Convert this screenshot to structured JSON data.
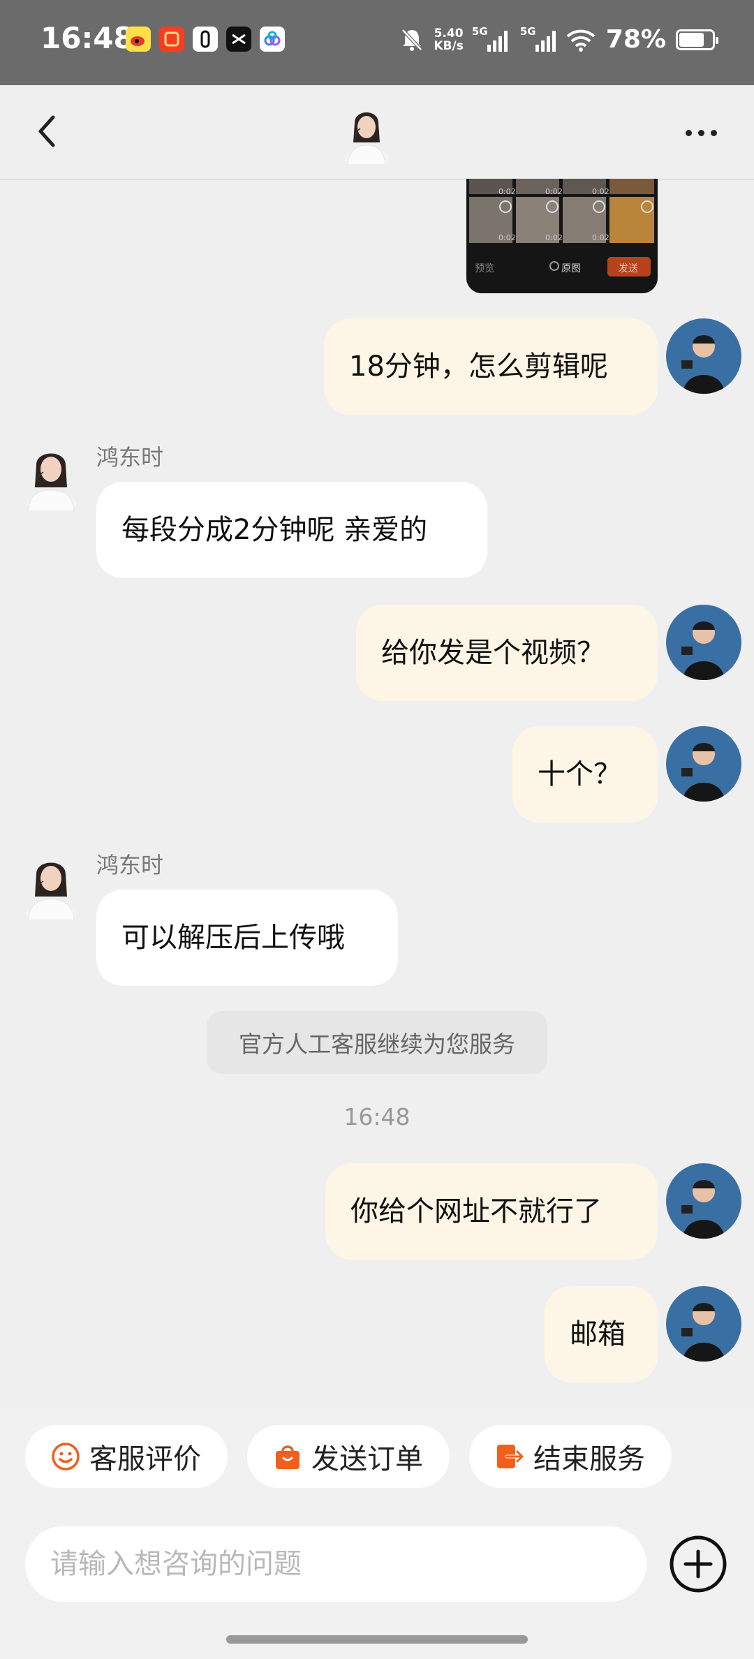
{
  "status_bar": {
    "time": "16:48",
    "net_speed_value": "5.40",
    "net_speed_unit": "KB/s",
    "signal1_label": "5G",
    "signal2_label": "5G",
    "battery": "78%",
    "battery_level": 0.78
  },
  "header": {
    "back_icon": "chevron-left-icon",
    "more_icon": "more-horizontal-icon"
  },
  "media_preview": {
    "timestamps": [
      "0:02",
      "0:02",
      "0:02",
      "0:02",
      "0:02",
      "0:02"
    ],
    "left_label": "预览",
    "center_label": "原图",
    "send_label": "发送"
  },
  "messages": [
    {
      "from": "user",
      "text": "18分钟，怎么剪辑呢"
    },
    {
      "from": "agent",
      "sender": "鸿东时",
      "text": "每段分成2分钟呢 亲爱的"
    },
    {
      "from": "user",
      "text": "给你发是个视频？"
    },
    {
      "from": "user",
      "text": "十个？"
    },
    {
      "from": "agent",
      "sender": "鸿东时",
      "text": "可以解压后上传哦"
    },
    {
      "from": "system",
      "text": "官方人工客服继续为您服务"
    },
    {
      "from": "time",
      "text": "16:48"
    },
    {
      "from": "user",
      "text": "你给个网址不就行了"
    },
    {
      "from": "user",
      "text": "邮箱"
    }
  ],
  "quick_actions": [
    {
      "label": "客服评价",
      "icon": "smiley-icon"
    },
    {
      "label": "发送订单",
      "icon": "shopping-bag-icon"
    },
    {
      "label": "结束服务",
      "icon": "exit-icon"
    }
  ],
  "input": {
    "placeholder": "请输入想咨询的问题",
    "value": ""
  },
  "colors": {
    "status_bar_bg": "#6b6b6b",
    "page_bg": "#efefef",
    "outgoing_bubble": "#fdf6e6",
    "incoming_bubble": "#ffffff",
    "accent_orange": "#f0601c"
  }
}
